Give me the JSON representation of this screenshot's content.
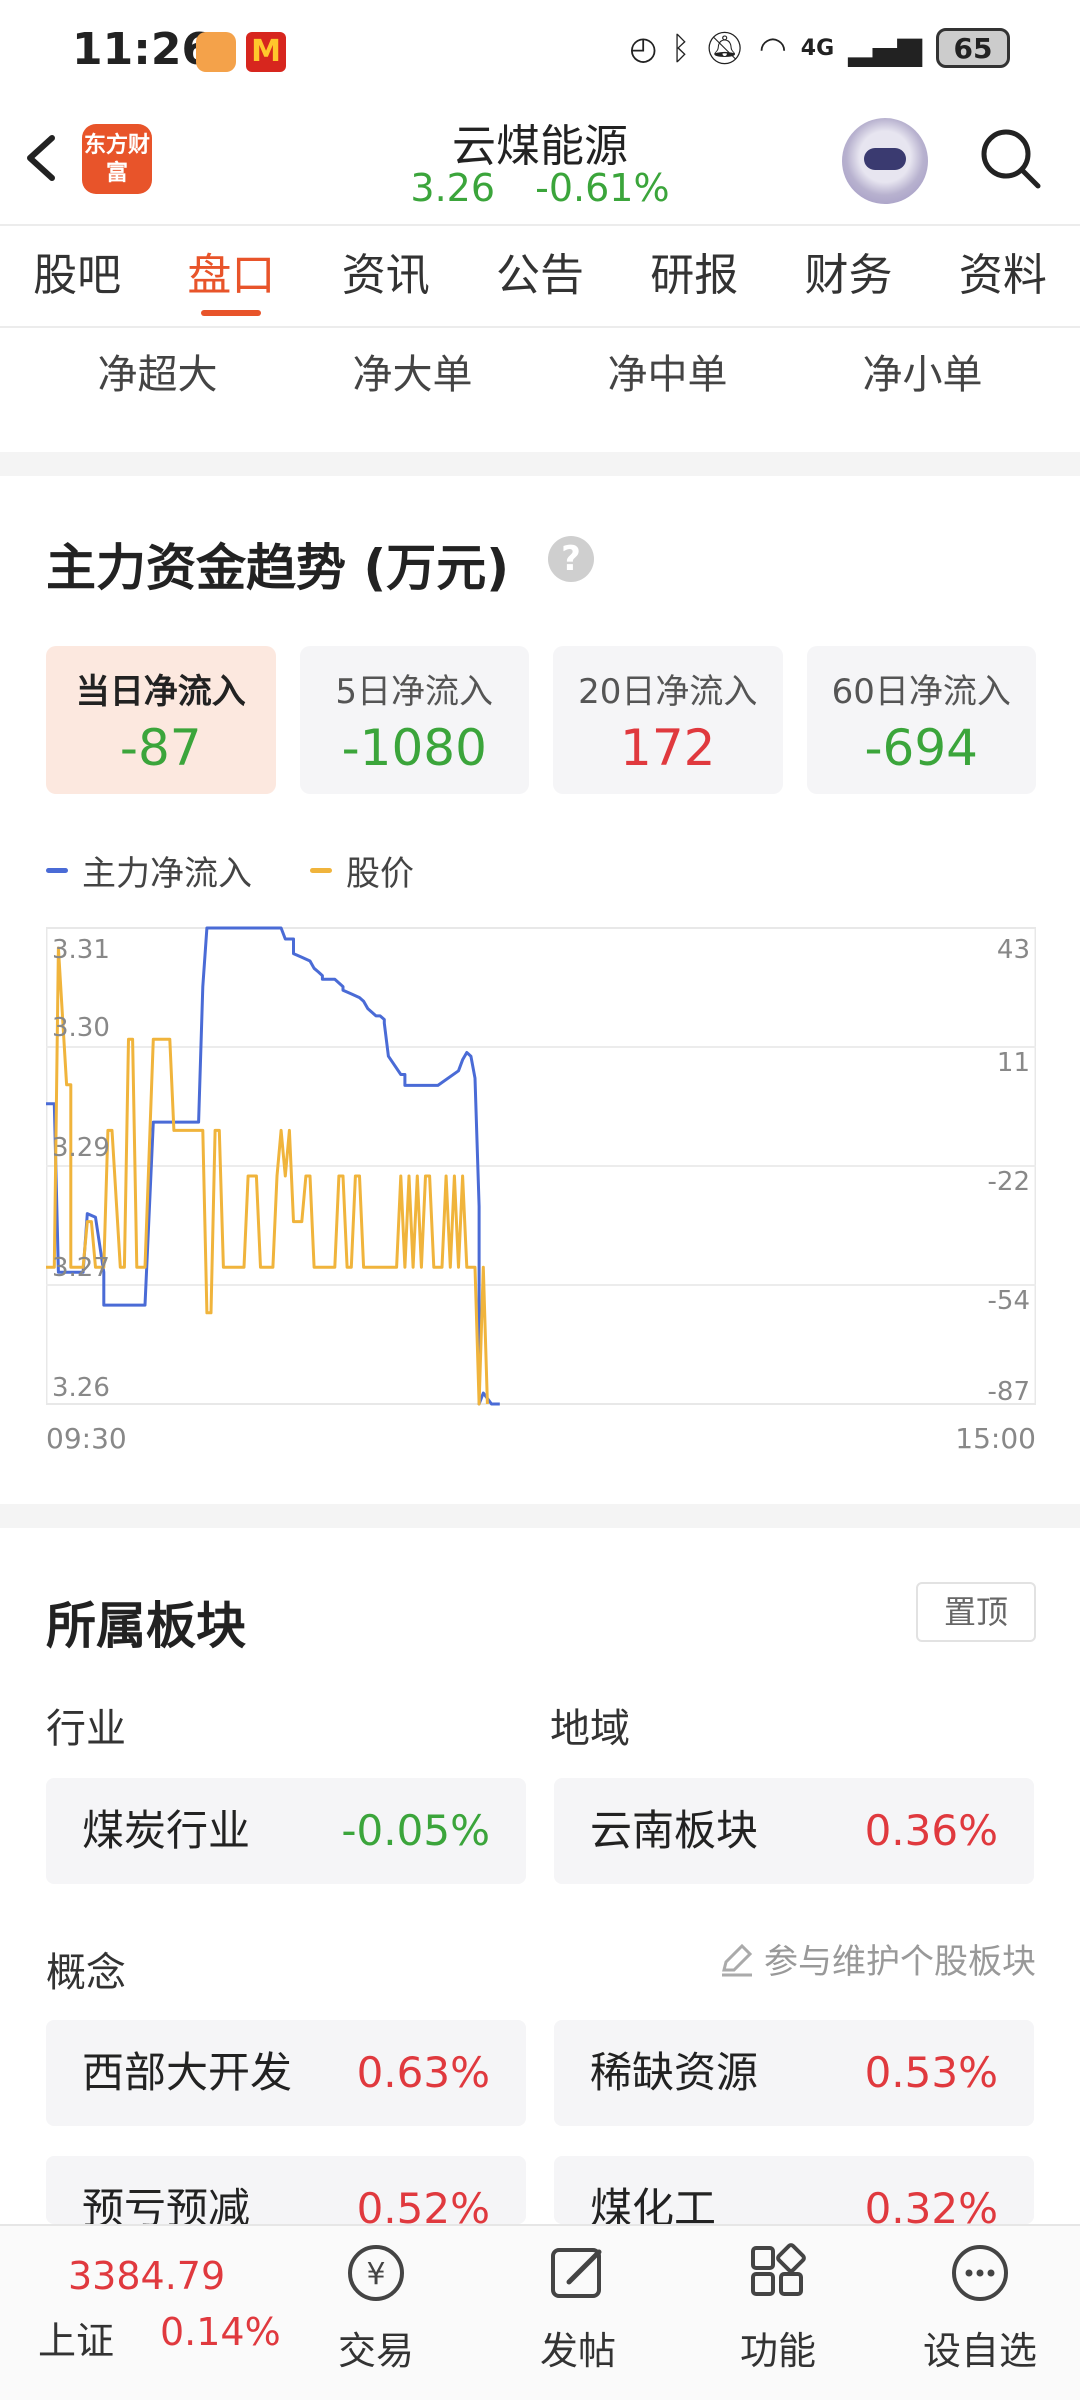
{
  "status_bar": {
    "time": "11:26",
    "signal": "4G",
    "battery": "65"
  },
  "header": {
    "logo_text": "东方财富",
    "stock_name": "云煤能源",
    "price": "3.26",
    "change_pct": "-0.61%"
  },
  "tabs": [
    "股吧",
    "盘口",
    "资讯",
    "公告",
    "研报",
    "财务",
    "资料"
  ],
  "active_tab": "盘口",
  "sub_tabs": [
    "净超大",
    "净大单",
    "净中单",
    "净小单"
  ],
  "fund_trend": {
    "title": "主力资金趋势 (万元)",
    "help": "?",
    "cards": [
      {
        "label": "当日净流入",
        "value": "-87",
        "color": "green",
        "active": true
      },
      {
        "label": "5日净流入",
        "value": "-1080",
        "color": "green",
        "active": false
      },
      {
        "label": "20日净流入",
        "value": "172",
        "color": "red",
        "active": false
      },
      {
        "label": "60日净流入",
        "value": "-694",
        "color": "green",
        "active": false
      }
    ]
  },
  "chart_data": {
    "type": "line",
    "x_start_label": "09:30",
    "x_end_label": "15:00",
    "y_left_ticks": [
      "3.31",
      "3.30",
      "3.29",
      "3.27",
      "3.26"
    ],
    "y_right_ticks": [
      "43",
      "11",
      "-22",
      "-54",
      "-87"
    ],
    "ylim_price": [
      3.26,
      3.31
    ],
    "ylim_flow": [
      -87,
      43
    ],
    "grid": true,
    "legend_placement": "top-left",
    "series": [
      {
        "name": "主力净流入",
        "color": "#4a6bd6",
        "axis": "right",
        "x": [
          0,
          2,
          3,
          9,
          10,
          12,
          14,
          14,
          16,
          21,
          22,
          24,
          26,
          29,
          30,
          36,
          37,
          38,
          39,
          45,
          56,
          57,
          58,
          60,
          60,
          62,
          64,
          65,
          66,
          67,
          67,
          70,
          72,
          72,
          74,
          76,
          77,
          78,
          79,
          80,
          81,
          82,
          82,
          83,
          86,
          87,
          87,
          89,
          90,
          92,
          95,
          100,
          101,
          102,
          103,
          104,
          105,
          105,
          106,
          108,
          109,
          110
        ],
        "y": [
          -5,
          -5,
          -51,
          -51,
          -35,
          -36,
          -51,
          -60,
          -60,
          -60,
          -60,
          -60,
          -10,
          -10,
          -10,
          -10,
          -10,
          27,
          43,
          43,
          43,
          43,
          40,
          40,
          36,
          35,
          34,
          32,
          31,
          30,
          29,
          29,
          27,
          26,
          25,
          24,
          23,
          21,
          20,
          19,
          19,
          18,
          17,
          8,
          3,
          3,
          0,
          0,
          0,
          0,
          0,
          4,
          7,
          9,
          8,
          2,
          -33,
          -87,
          -84,
          -87,
          -87,
          -87
        ],
        "note_unit": "minute index of 240-min session (first ~110 min shown)"
      },
      {
        "name": "股价",
        "color": "#f0b43c",
        "axis": "left",
        "x": [
          0,
          2,
          3,
          3,
          5,
          6,
          6,
          8,
          9,
          10,
          11,
          12,
          14,
          15,
          16,
          18,
          19,
          20,
          21,
          22,
          23,
          24,
          26,
          27,
          28,
          29,
          30,
          31,
          33,
          34,
          35,
          36,
          37,
          38,
          39,
          40,
          41,
          42,
          43,
          45,
          46,
          47,
          48,
          49,
          50,
          51,
          52,
          53,
          54,
          55,
          56,
          57,
          58,
          59,
          60,
          61,
          62,
          63,
          64,
          65,
          66,
          67,
          68,
          70,
          71,
          72,
          73,
          74,
          75,
          76,
          77,
          78,
          79,
          80,
          81,
          82,
          83,
          84,
          85,
          86,
          87,
          88,
          89,
          90,
          91,
          92,
          93,
          94,
          95,
          96,
          97,
          98,
          99,
          100,
          101,
          102,
          103,
          104,
          105,
          106,
          107
        ],
        "y": [
          3.275,
          3.275,
          3.31,
          3.31,
          3.295,
          3.295,
          3.275,
          3.275,
          3.275,
          3.28,
          3.28,
          3.275,
          3.275,
          3.29,
          3.29,
          3.275,
          3.275,
          3.3,
          3.3,
          3.275,
          3.275,
          3.275,
          3.3,
          3.3,
          3.3,
          3.3,
          3.3,
          3.29,
          3.29,
          3.29,
          3.29,
          3.29,
          3.29,
          3.29,
          3.27,
          3.27,
          3.29,
          3.29,
          3.275,
          3.275,
          3.275,
          3.275,
          3.275,
          3.285,
          3.285,
          3.285,
          3.275,
          3.275,
          3.275,
          3.275,
          3.285,
          3.29,
          3.285,
          3.29,
          3.28,
          3.28,
          3.28,
          3.285,
          3.285,
          3.275,
          3.275,
          3.275,
          3.275,
          3.275,
          3.285,
          3.285,
          3.275,
          3.275,
          3.285,
          3.285,
          3.275,
          3.275,
          3.275,
          3.275,
          3.275,
          3.275,
          3.275,
          3.275,
          3.275,
          3.285,
          3.275,
          3.285,
          3.275,
          3.285,
          3.275,
          3.285,
          3.285,
          3.275,
          3.275,
          3.275,
          3.285,
          3.275,
          3.285,
          3.275,
          3.285,
          3.275,
          3.275,
          3.275,
          3.26,
          3.275,
          3.26
        ]
      }
    ]
  },
  "sectors": {
    "title": "所属板块",
    "pin_label": "置顶",
    "industry_label": "行业",
    "region_label": "地域",
    "concept_label": "概念",
    "maintain_link": "参与维护个股板块",
    "industry": {
      "name": "煤炭行业",
      "pct": "-0.05%",
      "color": "green"
    },
    "region": {
      "name": "云南板块",
      "pct": "0.36%",
      "color": "red"
    },
    "concepts": [
      {
        "name": "西部大开发",
        "pct": "0.63%",
        "color": "red"
      },
      {
        "name": "稀缺资源",
        "pct": "0.53%",
        "color": "red"
      },
      {
        "name": "预亏预减",
        "pct": "0.52%",
        "color": "red"
      },
      {
        "name": "煤化工",
        "pct": "0.32%",
        "color": "red"
      }
    ]
  },
  "bottom_bar": {
    "index_value": "3384.79",
    "index_name": "上证",
    "index_pct": "0.14%",
    "items": [
      {
        "label": "交易",
        "icon": "trade-icon"
      },
      {
        "label": "发帖",
        "icon": "post-icon"
      },
      {
        "label": "功能",
        "icon": "apps-icon"
      },
      {
        "label": "设自选",
        "icon": "more-icon"
      }
    ]
  },
  "colors": {
    "accent": "#e8542a",
    "up": "#e0393e",
    "down": "#3ba53b",
    "flow_line": "#4a6bd6",
    "price_line": "#f0b43c"
  }
}
